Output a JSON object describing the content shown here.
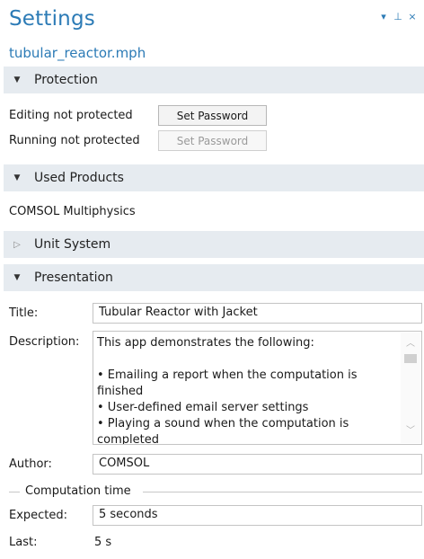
{
  "header": {
    "title": "Settings",
    "subtitle": "tubular_reactor.mph",
    "controls": {
      "menu_icon": "▾",
      "pin_icon": "⊥",
      "close_icon": "×"
    }
  },
  "protection": {
    "label": "Protection",
    "editing_text": "Editing not protected",
    "editing_button": "Set Password",
    "running_text": "Running not protected",
    "running_button": "Set Password"
  },
  "used_products": {
    "label": "Used Products",
    "item": "COMSOL Multiphysics"
  },
  "unit_system": {
    "label": "Unit System"
  },
  "presentation": {
    "label": "Presentation",
    "title_label": "Title:",
    "title_value": "Tubular Reactor with Jacket",
    "description_label": "Description:",
    "description_value": "This app demonstrates the following:\n\n• Emailing a report when the computation is finished\n• User-defined email server settings\n• Playing a sound when the computation is completed",
    "author_label": "Author:",
    "author_value": "COMSOL",
    "computation_group": "Computation time",
    "expected_label": "Expected:",
    "expected_value": "5 seconds",
    "last_label": "Last:",
    "last_value": "5 s"
  },
  "colors": {
    "accent": "#2c7bb6",
    "section_bg": "#e6ebf0"
  }
}
